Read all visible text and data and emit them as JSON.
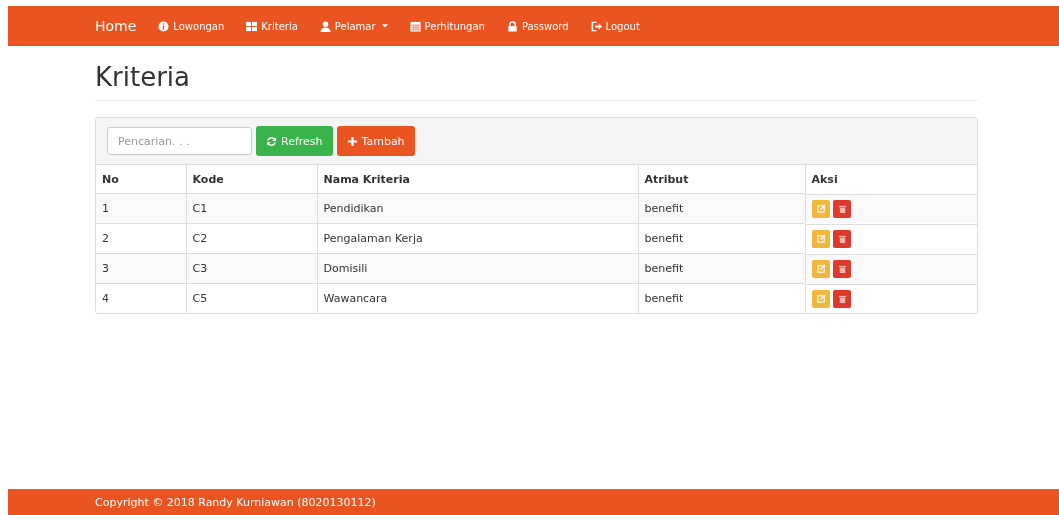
{
  "navbar": {
    "brand": "Home",
    "items": [
      {
        "label": "Lowongan",
        "kind": "info"
      },
      {
        "label": "Kriteria",
        "kind": "grid"
      },
      {
        "label": "Pelamar",
        "kind": "user",
        "dropdown": true
      },
      {
        "label": "Perhitungan",
        "kind": "calendar"
      },
      {
        "label": "Password",
        "kind": "lock"
      },
      {
        "label": "Logout",
        "kind": "logout"
      }
    ]
  },
  "page_title": "Kriteria",
  "toolbar": {
    "search": {
      "placeholder": "Pencarian. . ."
    },
    "buttons": [
      {
        "label": "Refresh",
        "kind": "refresh"
      },
      {
        "label": "Tambah",
        "kind": "add"
      }
    ]
  },
  "table": {
    "columns": [
      "No",
      "Kode",
      "Nama Kriteria",
      "Atribut",
      "Aksi"
    ],
    "rows": [
      {
        "cells": [
          "1",
          "C1",
          "Pendidikan",
          "benefit"
        ]
      },
      {
        "cells": [
          "2",
          "C2",
          "Pengalaman Kerja",
          "benefit"
        ]
      },
      {
        "cells": [
          "3",
          "C3",
          "Domisili",
          "benefit"
        ]
      },
      {
        "cells": [
          "4",
          "C5",
          "Wawancara",
          "benefit"
        ]
      }
    ]
  },
  "footer": "Copyright © 2018 Randy Kurniawan (8020130112)"
}
